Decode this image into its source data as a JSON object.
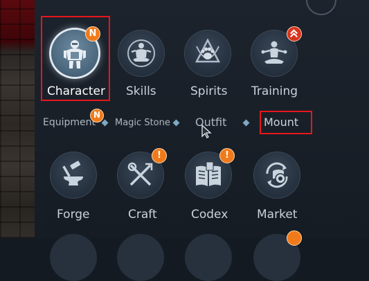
{
  "main_menu": [
    {
      "label": "Character",
      "icon": "character-armor-icon",
      "badge": "N"
    },
    {
      "label": "Skills",
      "icon": "skills-meditation-icon"
    },
    {
      "label": "Spirits",
      "icon": "spirits-paw-icon"
    },
    {
      "label": "Training",
      "icon": "training-meditation-icon"
    }
  ],
  "sub_menu": [
    "Equipment",
    "Magic Stone",
    "Outfit",
    "Mount"
  ],
  "sub_badge": "N",
  "second_menu": [
    {
      "label": "Forge",
      "icon": "anvil-hammer-icon"
    },
    {
      "label": "Craft",
      "icon": "craft-tools-icon",
      "badge": "!"
    },
    {
      "label": "Codex",
      "icon": "codex-book-icon",
      "badge": "!"
    },
    {
      "label": "Market",
      "icon": "market-coins-icon"
    }
  ],
  "colors": {
    "highlight": "#e8161c",
    "badge_orange": "#f07a1a",
    "badge_red": "#d8351e"
  }
}
